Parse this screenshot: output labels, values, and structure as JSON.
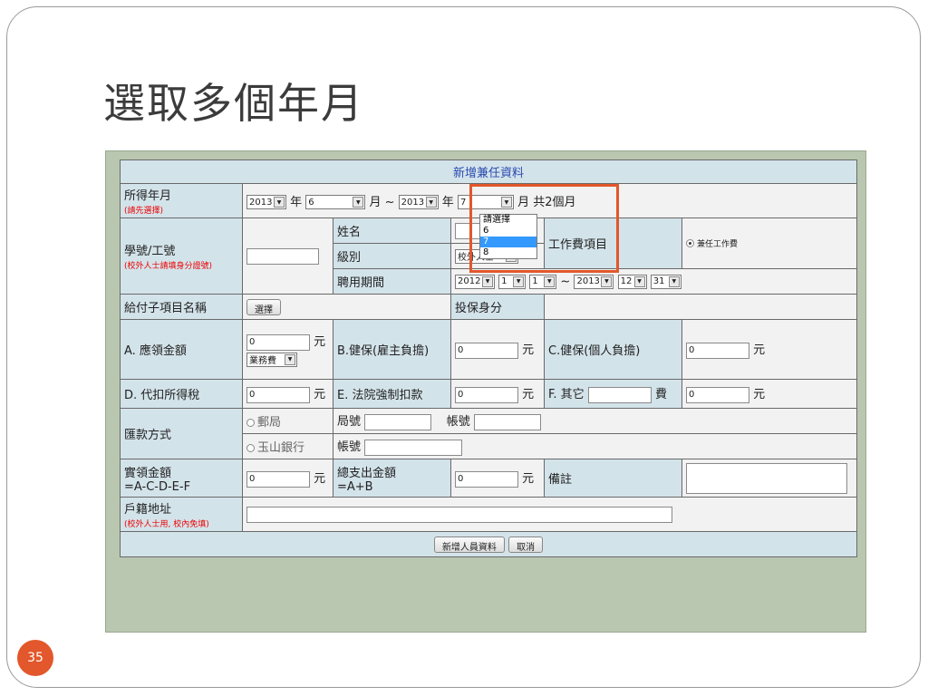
{
  "slide": {
    "title": "選取多個年月",
    "page_number": "35"
  },
  "form": {
    "header": "新增兼任資料",
    "income_period": {
      "label": "所得年月",
      "hint": "(請先選擇)",
      "from_year": "2013",
      "year_unit": "年",
      "from_month": "6",
      "month_unit": "月",
      "sep": "~",
      "to_year": "2013",
      "to_year_unit": "年",
      "to_month": "7",
      "summary": "月 共2個月",
      "dropdown_options": [
        "請選擇",
        "6",
        "7",
        "8"
      ],
      "dropdown_selected": "7"
    },
    "id_row": {
      "label": "學號/工號",
      "hint": "(校外人士請填身分證號)",
      "id_value": "",
      "name_label": "姓名",
      "name_value": "",
      "grade_label": "級別",
      "grade_value": "校外人士",
      "work_item_label": "工作費項目",
      "work_item_option": "兼任工作費",
      "period_label": "聘用期間",
      "period": {
        "y1": "2012",
        "m1": "1",
        "d1": "1",
        "sep": "~",
        "y2": "2013",
        "m2": "12",
        "d2": "31"
      }
    },
    "pay_item": {
      "label": "給付子項目名稱",
      "button": "選擇",
      "insure_label": "投保身分"
    },
    "row_a": {
      "label": "A. 應領金額",
      "a_value": "0",
      "unit": "元",
      "a_type": "業務費",
      "b_label": "B.健保(雇主負擔)",
      "b_value": "0",
      "b_unit": "元",
      "c_label": "C.健保(個人負擔)",
      "c_value": "0",
      "c_unit": "元"
    },
    "row_d": {
      "label": "D. 代扣所得稅",
      "d_value": "0",
      "unit": "元",
      "e_label": "E. 法院強制扣款",
      "e_value": "0",
      "e_unit": "元",
      "f_label": "F. 其它",
      "f_suffix": "費",
      "f_value": "0",
      "f_unit": "元"
    },
    "remit": {
      "label": "匯款方式",
      "post": "郵局",
      "branch_label": "局號",
      "acct_label": "帳號",
      "bank": "玉山銀行",
      "bank_acct_label": "帳號"
    },
    "total": {
      "label1": "實領金額",
      "label2": "=A-C-D-E-F",
      "value": "0",
      "unit": "元",
      "total_label1": "總支出金額",
      "total_label2": "=A+B",
      "total_value": "0",
      "total_unit": "元",
      "note_label": "備註"
    },
    "address": {
      "label": "戶籍地址",
      "hint": "(校外人士用, 校內免填)"
    },
    "actions": {
      "submit": "新增人員資料",
      "cancel": "取消"
    }
  },
  "colors": {
    "accent": "#e2572b",
    "highlight": "#3399ff",
    "header_text": "#2a4ab0",
    "label_bg": "#d3e3ea"
  }
}
